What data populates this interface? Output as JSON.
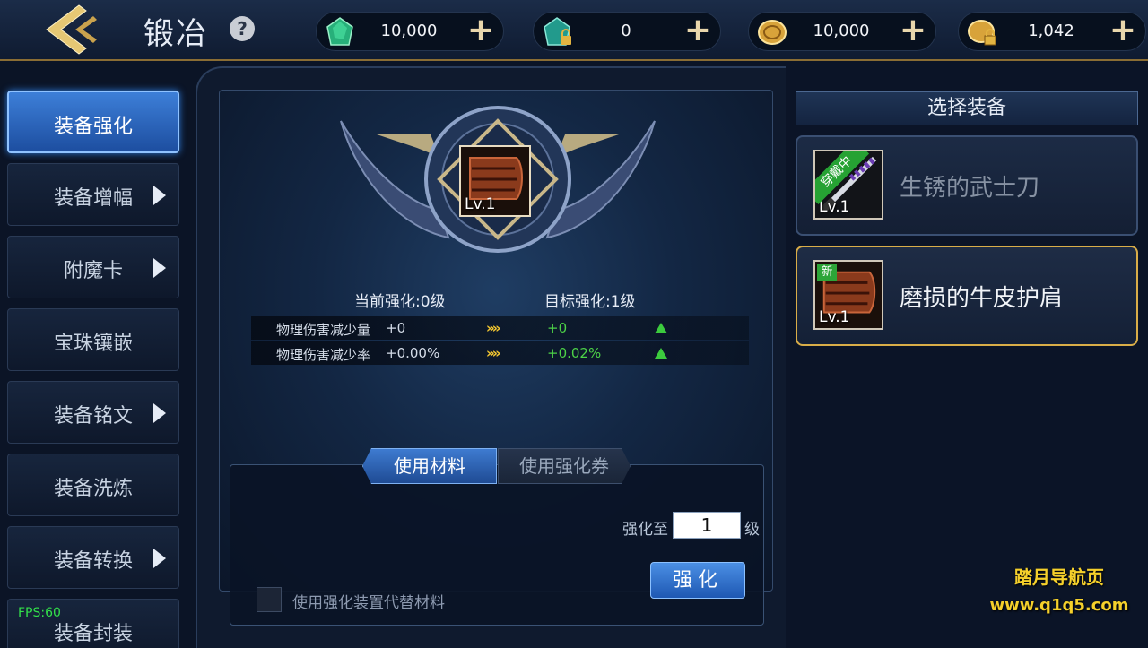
{
  "header": {
    "title": "锻冶",
    "help_icon": "?",
    "currencies": [
      {
        "icon": "green-gem-icon",
        "value": "10,000",
        "color": "#2ec27e"
      },
      {
        "icon": "locked-gem-icon",
        "value": "0",
        "color": "#2aa4a0"
      },
      {
        "icon": "gold-coin-icon",
        "value": "10,000",
        "color": "#d9a53a"
      },
      {
        "icon": "locked-coin-icon",
        "value": "1,042",
        "color": "#d9a53a"
      }
    ],
    "plus_label": "+"
  },
  "menu": {
    "items": [
      {
        "label": "装备强化",
        "active": true,
        "has_arrow": false
      },
      {
        "label": "装备增幅",
        "active": false,
        "has_arrow": true
      },
      {
        "label": "附魔卡",
        "active": false,
        "has_arrow": true
      },
      {
        "label": "宝珠镶嵌",
        "active": false,
        "has_arrow": false
      },
      {
        "label": "装备铭文",
        "active": false,
        "has_arrow": true
      },
      {
        "label": "装备洗炼",
        "active": false,
        "has_arrow": false
      },
      {
        "label": "装备转换",
        "active": false,
        "has_arrow": true
      },
      {
        "label": "装备封装",
        "active": false,
        "has_arrow": false
      }
    ]
  },
  "fps": "FPS:60",
  "enhance": {
    "item_level": "Lv.1",
    "current_label": "当前强化:0级",
    "target_label": "目标强化:1级",
    "stats": [
      {
        "name": "物理伤害减少量",
        "current": "+0",
        "next": "+0"
      },
      {
        "name": "物理伤害减少率",
        "current": "+0.00%",
        "next": "+0.02%"
      }
    ],
    "arrow_glyph": "»»"
  },
  "materials": {
    "tabs": [
      "使用材料",
      "使用强化券"
    ],
    "qty_label": "强化至",
    "qty_value": "1",
    "qty_unit": "级",
    "enhance_button": "强化",
    "substitute_label": "使用强化装置代替材料"
  },
  "right": {
    "title": "选择装备",
    "items": [
      {
        "name": "生锈的武士刀",
        "level": "Lv.1",
        "badge": "穿戴中"
      },
      {
        "name": "磨损的牛皮护肩",
        "level": "Lv.1",
        "badge": "新"
      }
    ]
  },
  "watermark": {
    "line1": "踏月导航页",
    "line2": "www.q1q5.com"
  }
}
